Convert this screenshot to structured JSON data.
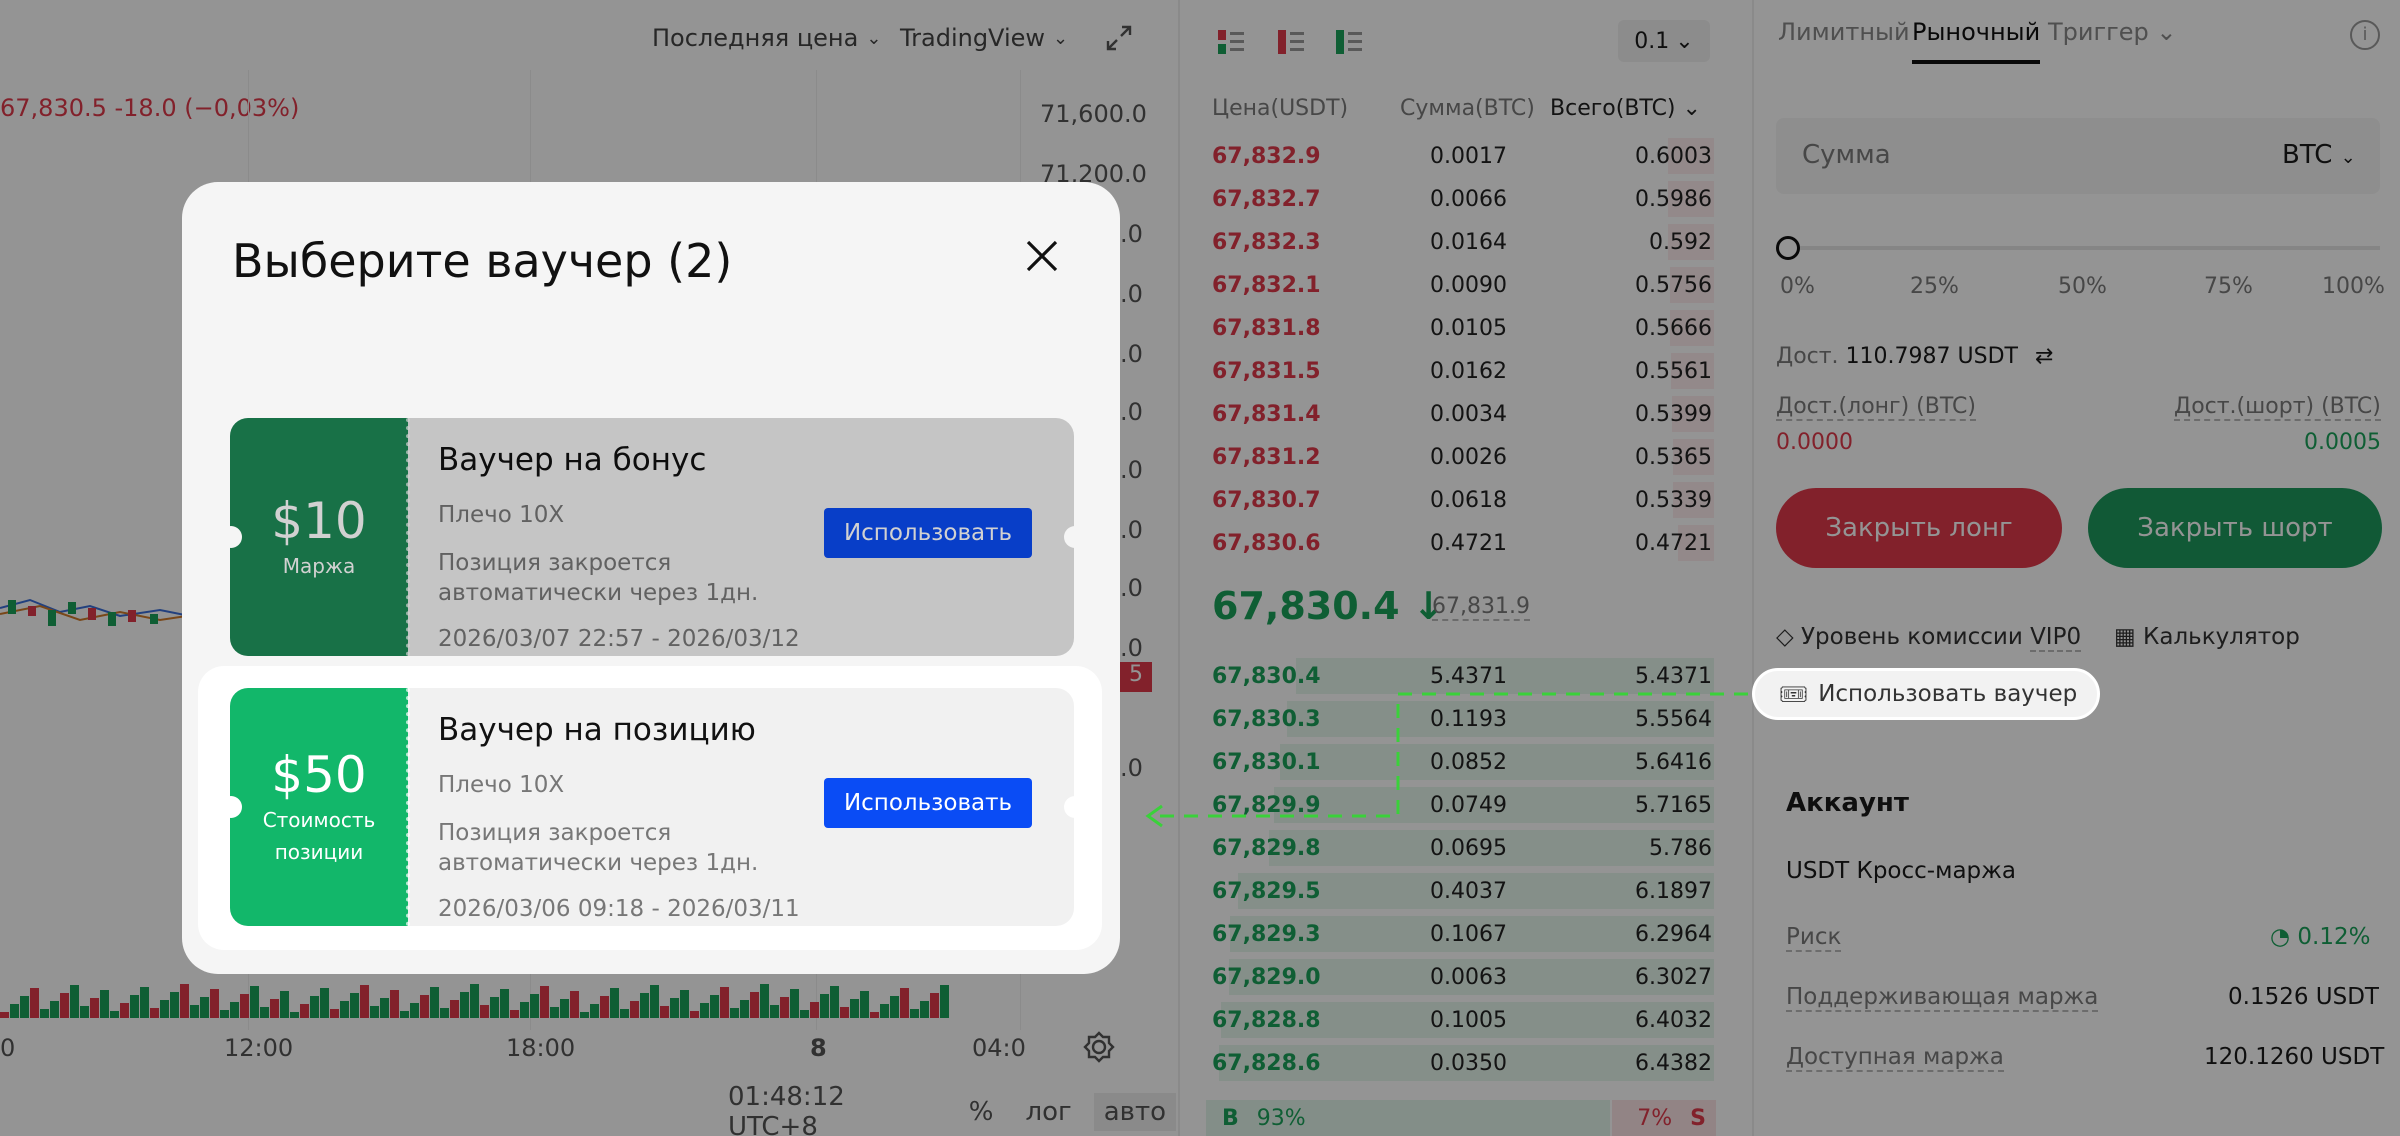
{
  "chart": {
    "toolbar": {
      "last_price_label": "Последняя цена",
      "tradingview_label": "TradingView"
    },
    "price_line": "67,830.5  -18.0 (−0,03%)",
    "y_axis": [
      "71,600.0",
      "71,200.0",
      ".0",
      ".0",
      ".0",
      ".0",
      ".0",
      ".0",
      ".0",
      ".0",
      ".0",
      ".0",
      ".0"
    ],
    "x_axis": [
      "0",
      "12:00",
      "18:00",
      "8",
      "04:0"
    ],
    "price_badge": "5",
    "footer": {
      "time": "01:48:12 UTC+8",
      "percent": "%",
      "log": "лог",
      "auto": "авто"
    }
  },
  "orderbook": {
    "size_select": "0.1",
    "headers": {
      "price": "Цена(USDT)",
      "amount": "Сумма(BTC)",
      "total": "Всего(BTC)"
    },
    "asks": [
      [
        "67,832.9",
        "0.0017",
        "0.6003"
      ],
      [
        "67,832.7",
        "0.0066",
        "0.5986"
      ],
      [
        "67,832.3",
        "0.0164",
        "0.592"
      ],
      [
        "67,832.1",
        "0.0090",
        "0.5756"
      ],
      [
        "67,831.8",
        "0.0105",
        "0.5666"
      ],
      [
        "67,831.5",
        "0.0162",
        "0.5561"
      ],
      [
        "67,831.4",
        "0.0034",
        "0.5399"
      ],
      [
        "67,831.2",
        "0.0026",
        "0.5365"
      ],
      [
        "67,830.7",
        "0.0618",
        "0.5339"
      ],
      [
        "67,830.6",
        "0.4721",
        "0.4721"
      ]
    ],
    "mid_price": "67,830.4",
    "mark_price": "67,831.9",
    "bids": [
      [
        "67,830.4",
        "5.4371",
        "5.4371"
      ],
      [
        "67,830.3",
        "0.1193",
        "5.5564"
      ],
      [
        "67,830.1",
        "0.0852",
        "5.6416"
      ],
      [
        "67,829.9",
        "0.0749",
        "5.7165"
      ],
      [
        "67,829.8",
        "0.0695",
        "5.786"
      ],
      [
        "67,829.5",
        "0.4037",
        "6.1897"
      ],
      [
        "67,829.3",
        "0.1067",
        "6.2964"
      ],
      [
        "67,829.0",
        "0.0063",
        "6.3027"
      ],
      [
        "67,828.8",
        "0.1005",
        "6.4032"
      ],
      [
        "67,828.6",
        "0.0350",
        "6.4382"
      ]
    ],
    "ratio": {
      "buy_label": "B",
      "buy_pct": "93%",
      "sell_pct": "7%",
      "sell_label": "S"
    }
  },
  "trade": {
    "tabs": {
      "limit": "Лимитный",
      "market": "Рыночный",
      "trigger": "Триггер"
    },
    "amount_placeholder": "Сумма",
    "currency": "BTC",
    "slider_marks": [
      "0%",
      "25%",
      "50%",
      "75%",
      "100%"
    ],
    "available_label": "Дост.",
    "available_value": "110.7987 USDT",
    "long_avail_label": "Дост.(лонг) (BTC)",
    "long_avail_value": "0.0000",
    "short_avail_label": "Дост.(шорт) (BTC)",
    "short_avail_value": "0.0005",
    "close_long": "Закрыть лонг",
    "close_short": "Закрыть шорт",
    "fee_level_label": "Уровень комиссии",
    "fee_level_value": "VIP0",
    "calculator": "Калькулятор",
    "use_voucher": "Использовать ваучер",
    "account": {
      "title": "Аккаунт",
      "mode": "USDT Кросс-маржа",
      "risk_label": "Риск",
      "risk_value": "0.12%",
      "maint_margin_label": "Поддерживающая маржа",
      "maint_margin_value": "0.1526 USDT",
      "avail_margin_label": "Доступная маржа",
      "avail_margin_value": "120.1260 USDT"
    }
  },
  "modal": {
    "title": "Выберите ваучер (2)",
    "vouchers": [
      {
        "amount": "$10",
        "amount_label": "Маржа",
        "title": "Ваучер на бонус",
        "leverage": "Плечо 10X",
        "description": "Позиция закроется автоматически через 1дн.",
        "dates": "2026/03/07 22:57 - 2026/03/12",
        "button": "Использовать",
        "color": "#1e8a57"
      },
      {
        "amount": "$50",
        "amount_label": "Стоимость позиции",
        "title": "Ваучер на позицию",
        "leverage": "Плечо 10X",
        "description": "Позиция закроется автоматически через 1дн.",
        "dates": "2026/03/06 09:18 - 2026/03/11",
        "button": "Использовать",
        "color": "#12b76a"
      }
    ]
  },
  "colors": {
    "ask": "#e0394a",
    "bid": "#1aa35b",
    "accent": "#0a4cf5",
    "callout": "#3ad13a"
  }
}
